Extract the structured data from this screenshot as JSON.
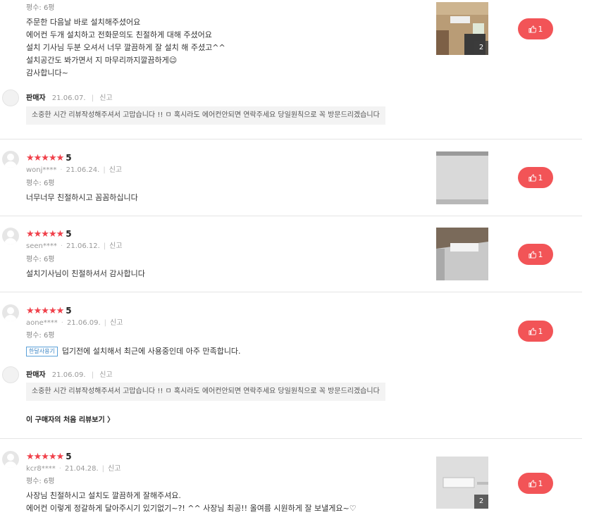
{
  "reviews": [
    {
      "size": "평수: 6평",
      "lines": [
        "주문한 다음날 바로 설치해주셨어요",
        "에어컨 두개 설치하고 전화문의도 친절하게 대해 주셨어요",
        "설치 기사님 두분 오셔서 너무 깔끔하게 잘 설치 해 주셨고^^",
        "설치공간도 봐가면서 지 마무리까지깔끔하게😉",
        "감사합니다~"
      ],
      "image_count": "2",
      "likes": "1",
      "reply": {
        "seller": "판매자",
        "date": "21.06.07.",
        "report": "신고",
        "text": "소중한 시간 리뷰작성해주셔서 고맙습니다 !! ㅁ 혹시라도 에어컨안되면 연락주세요 당일원칙으로 꼭 방문드리겠습니다"
      }
    },
    {
      "stars": "★★★★★",
      "score": "5",
      "user": "wonj****",
      "date": "21.06.24.",
      "report": "신고",
      "size": "평수: 6평",
      "lines": [
        "너무너무 친절하시고 꼼꼼하십니다"
      ],
      "likes": "1"
    },
    {
      "stars": "★★★★★",
      "score": "5",
      "user": "seen****",
      "date": "21.06.12.",
      "report": "신고",
      "size": "평수: 6평",
      "lines": [
        "설치기사님이 친절하셔서 감사합니다"
      ],
      "likes": "1"
    },
    {
      "stars": "★★★★★",
      "score": "5",
      "user": "aone****",
      "date": "21.06.09.",
      "report": "신고",
      "size": "평수: 6평",
      "tag": "한달사용기",
      "lines": [
        "덥기전에 설치해서 최근에 사용중인데 아주 만족합니다."
      ],
      "likes": "1",
      "reply": {
        "seller": "판매자",
        "date": "21.06.09.",
        "report": "신고",
        "text": "소중한 시간 리뷰작성해주셔서 고맙습니다 !! ㅁ 혹시라도 에어컨안되면 연락주세요 당일원칙으로 꼭 방문드리겠습니다"
      },
      "first_review_link": "이 구매자의 처음 리뷰보기 〉"
    },
    {
      "stars": "★★★★★",
      "score": "5",
      "user": "kcr8****",
      "date": "21.04.28.",
      "report": "신고",
      "size": "평수: 6평",
      "lines": [
        "사장님 친절하시고 설치도 깔끔하게 잘해주셔요.",
        "에어컨 이렇게 정갈하게 달아주시기 있기없기~?! ^^ 사장님 최공!! 올여름 시원하게 잘 보낼게요~♡"
      ],
      "image_count": "2",
      "likes": "1"
    }
  ],
  "colors": {
    "accent": "#f25457",
    "star": "#f0414b"
  },
  "icons": {
    "like": "thumbs-up-icon",
    "avatar": "user-avatar-icon"
  }
}
